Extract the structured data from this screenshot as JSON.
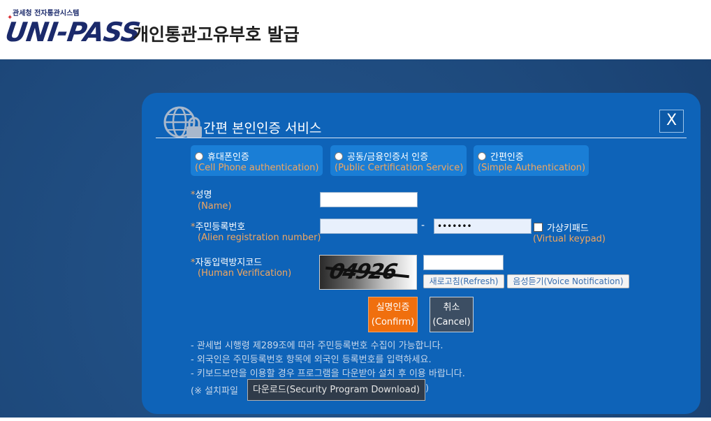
{
  "header": {
    "logo_sub": "관세청 전자통관시스템",
    "logo_main": "UNI-PASS",
    "title": "개인통관고유부호 발급"
  },
  "modal": {
    "icon": "globe-lock-icon",
    "title": "간편 본인인증 서비스",
    "close_label": "X",
    "auth_options": [
      {
        "label": "휴대폰인증",
        "label_en": "(Cell Phone authentication)"
      },
      {
        "label": "공동/금융인증서 인증",
        "label_en": "(Public Certification Service)"
      },
      {
        "label": "간편인증",
        "label_en": "(Simple Authentication)"
      }
    ],
    "fields": {
      "required_mark": "*",
      "name_label": "성명",
      "name_label_en": "(Name)",
      "reg_label": "주민등록번호",
      "reg_label_en": "(Alien registration number)",
      "reg_dash": "-",
      "reg_back_value": "•••••••",
      "virtual_keypad_label": "가상키패드",
      "virtual_keypad_label_en": "(Virtual keypad)",
      "captcha_label": "자동입력방지코드",
      "captcha_label_en": "(Human Verification)",
      "captcha_text": "04926"
    },
    "buttons": {
      "refresh": "새로고침(Refresh)",
      "voice": "음성듣기(Voice Notification)",
      "confirm_line1": "실명인증",
      "confirm_line2": "(Confirm)",
      "cancel_line1": "취소",
      "cancel_line2": "(Cancel)",
      "download": "다운로드(Security Program Download)"
    },
    "notes": [
      "- 관세법 시행령 제289조에 따라 주민등록번호 수집이 가능합니다.",
      "- 외국인은 주민등록번호 항목에 외국인 등록번호를 입력하세요.",
      "- 키보드보안을 이용할 경우 프로그램을 다운받아 설치 후 이용 바랍니다."
    ],
    "install_prefix": "(※ 설치파일",
    "install_suffix": ")"
  },
  "colors": {
    "modal_bg": "#0e63b8",
    "backdrop": "#1e4a7d",
    "accent_orange": "#f06f0e",
    "label_orange": "#f2a65e"
  }
}
